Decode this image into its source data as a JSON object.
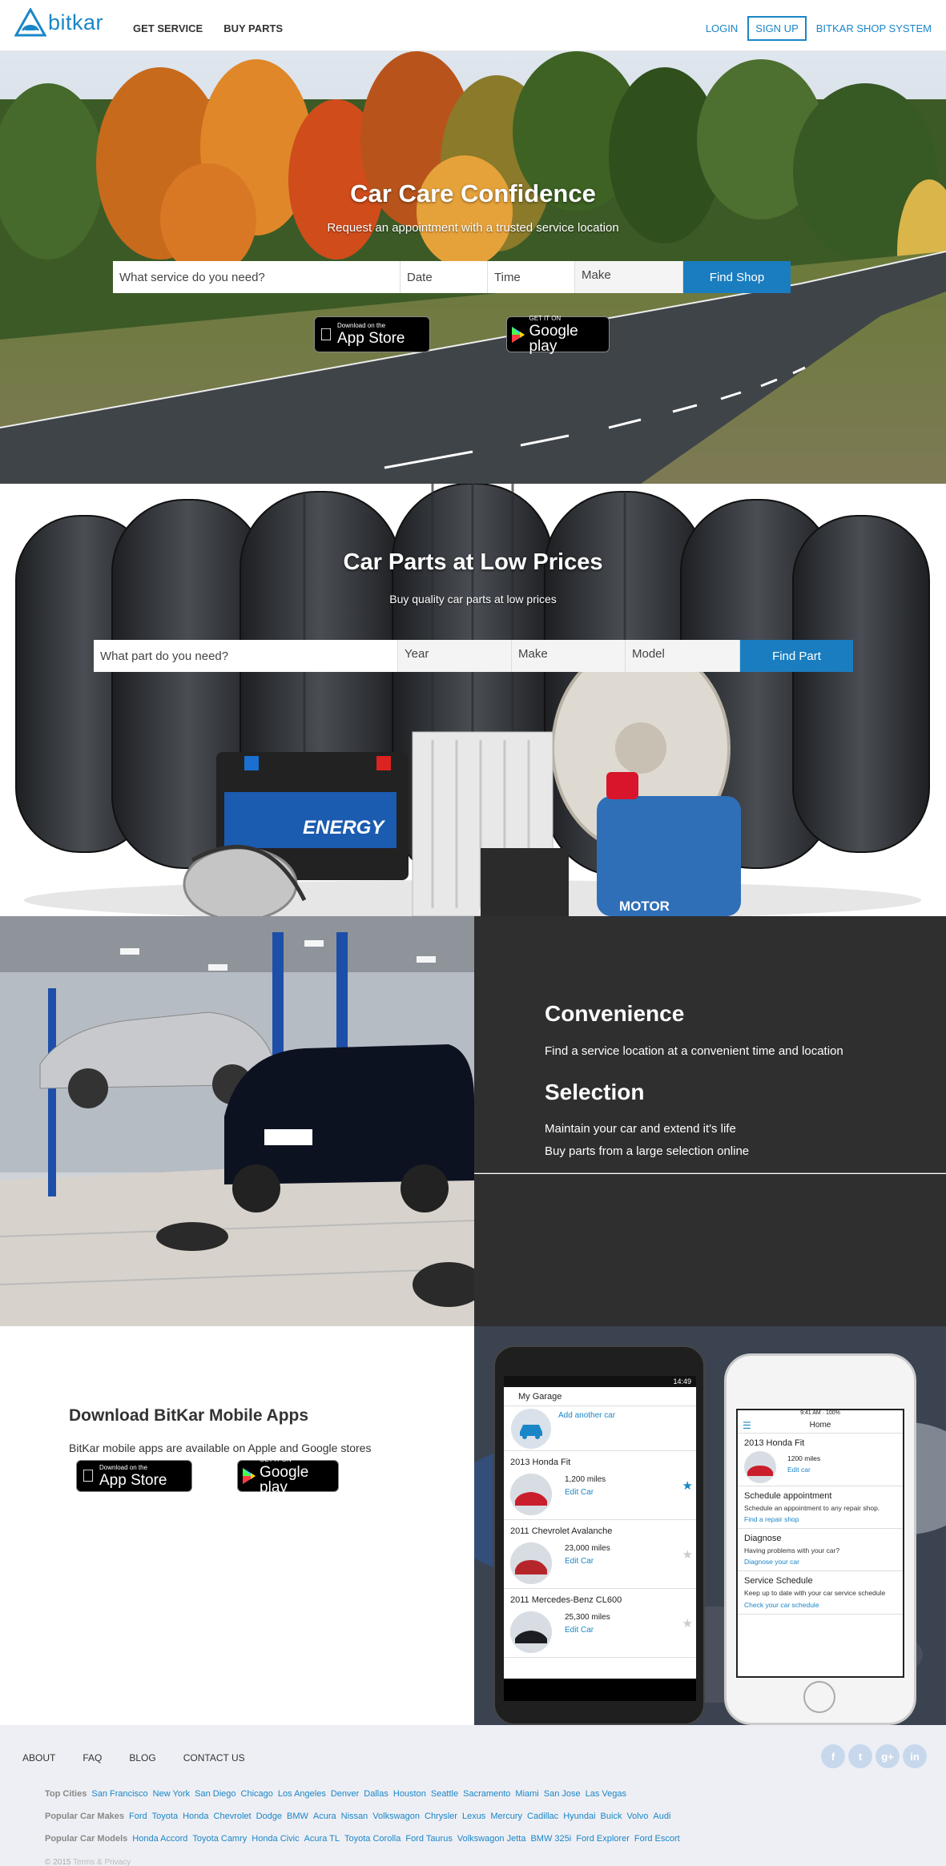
{
  "brand": {
    "name": "bitkar"
  },
  "nav": {
    "left": [
      "GET SERVICE",
      "BUY PARTS"
    ],
    "login": "LOGIN",
    "signup": "SIGN UP",
    "shop": "BITKAR SHOP SYSTEM"
  },
  "hero_service": {
    "title": "Car Care Confidence",
    "subtitle": "Request an appointment with a trusted service location",
    "service_placeholder": "What service do you need?",
    "date_placeholder": "Date",
    "time_placeholder": "Time",
    "make_placeholder": "Make",
    "button": "Find Shop"
  },
  "badges": {
    "appstore_small": "Download on the",
    "appstore_big": "App Store",
    "google_small": "GET IT ON",
    "google_big": "Google play"
  },
  "hero_parts": {
    "title": "Car Parts at Low Prices",
    "subtitle": "Buy quality car parts at low prices",
    "part_placeholder": "What part do you need?",
    "year_placeholder": "Year",
    "make_placeholder": "Make",
    "model_placeholder": "Model",
    "button": "Find Part",
    "battery_label": "ENERGY",
    "oil_label": "MOTOR"
  },
  "features": {
    "convenience_title": "Convenience",
    "convenience_text": "Find a service location at a convenient time and location",
    "selection_title": "Selection",
    "selection_line1": "Maintain your car and extend it's life",
    "selection_line2": "Buy parts from a large selection online"
  },
  "apps": {
    "title": "Download BitKar Mobile Apps",
    "text": "BitKar mobile apps are available on Apple and Google stores"
  },
  "android_screen": {
    "time": "14:49",
    "title": "My Garage",
    "add": "Add another car",
    "cars": [
      {
        "name": "2013 Honda Fit",
        "miles": "1,200 miles",
        "edit": "Edit Car",
        "starred": true
      },
      {
        "name": "2011 Chevrolet Avalanche",
        "miles": "23,000 miles",
        "edit": "Edit Car",
        "starred": false
      },
      {
        "name": "2011 Mercedes-Benz CL600",
        "miles": "25,300 miles",
        "edit": "Edit Car",
        "starred": false
      }
    ]
  },
  "iphone_screen": {
    "time": "9:41 AM",
    "battery": "100%",
    "title": "Home",
    "car_name": "2013 Honda Fit",
    "car_miles": "1200 miles",
    "car_edit": "Edit car",
    "blocks": [
      {
        "title": "Schedule appointment",
        "desc": "Schedule an appointment to any repair shop.",
        "link": "Find a repair shop"
      },
      {
        "title": "Diagnose",
        "desc": "Having problems with your car?",
        "link": "Diagnose your car"
      },
      {
        "title": "Service Schedule",
        "desc": "Keep up to date with your car service schedule",
        "link": "Check your car schedule"
      }
    ]
  },
  "footer": {
    "nav": [
      "ABOUT",
      "FAQ",
      "BLOG",
      "CONTACT US"
    ],
    "top_cities_label": "Top Cities",
    "top_cities": [
      "San Francisco",
      "New York",
      "San Diego",
      "Chicago",
      "Los Angeles",
      "Denver",
      "Dallas",
      "Houston",
      "Seattle",
      "Sacramento",
      "Miami",
      "San Jose",
      "Las Vegas"
    ],
    "makes_label": "Popular Car Makes",
    "makes": [
      "Ford",
      "Toyota",
      "Honda",
      "Chevrolet",
      "Dodge",
      "BMW",
      "Acura",
      "Nissan",
      "Volkswagon",
      "Chrysler",
      "Lexus",
      "Mercury",
      "Cadillac",
      "Hyundai",
      "Buick",
      "Volvo",
      "Audi"
    ],
    "models_label": "Popular Car Models",
    "models": [
      "Honda Accord",
      "Toyota Camry",
      "Honda Civic",
      "Acura TL",
      "Toyota Corolla",
      "Ford Taurus",
      "Volkswagon Jetta",
      "BMW 325i",
      "Ford Explorer",
      "Ford Escort"
    ],
    "copyright": "© 2015",
    "terms": "Terms & Privacy",
    "social": [
      "f",
      "t",
      "g+",
      "in"
    ]
  },
  "colors": {
    "accent": "#1a86c8",
    "dark_panel": "#2f2f2f",
    "footer_bg": "#eeeff4"
  }
}
